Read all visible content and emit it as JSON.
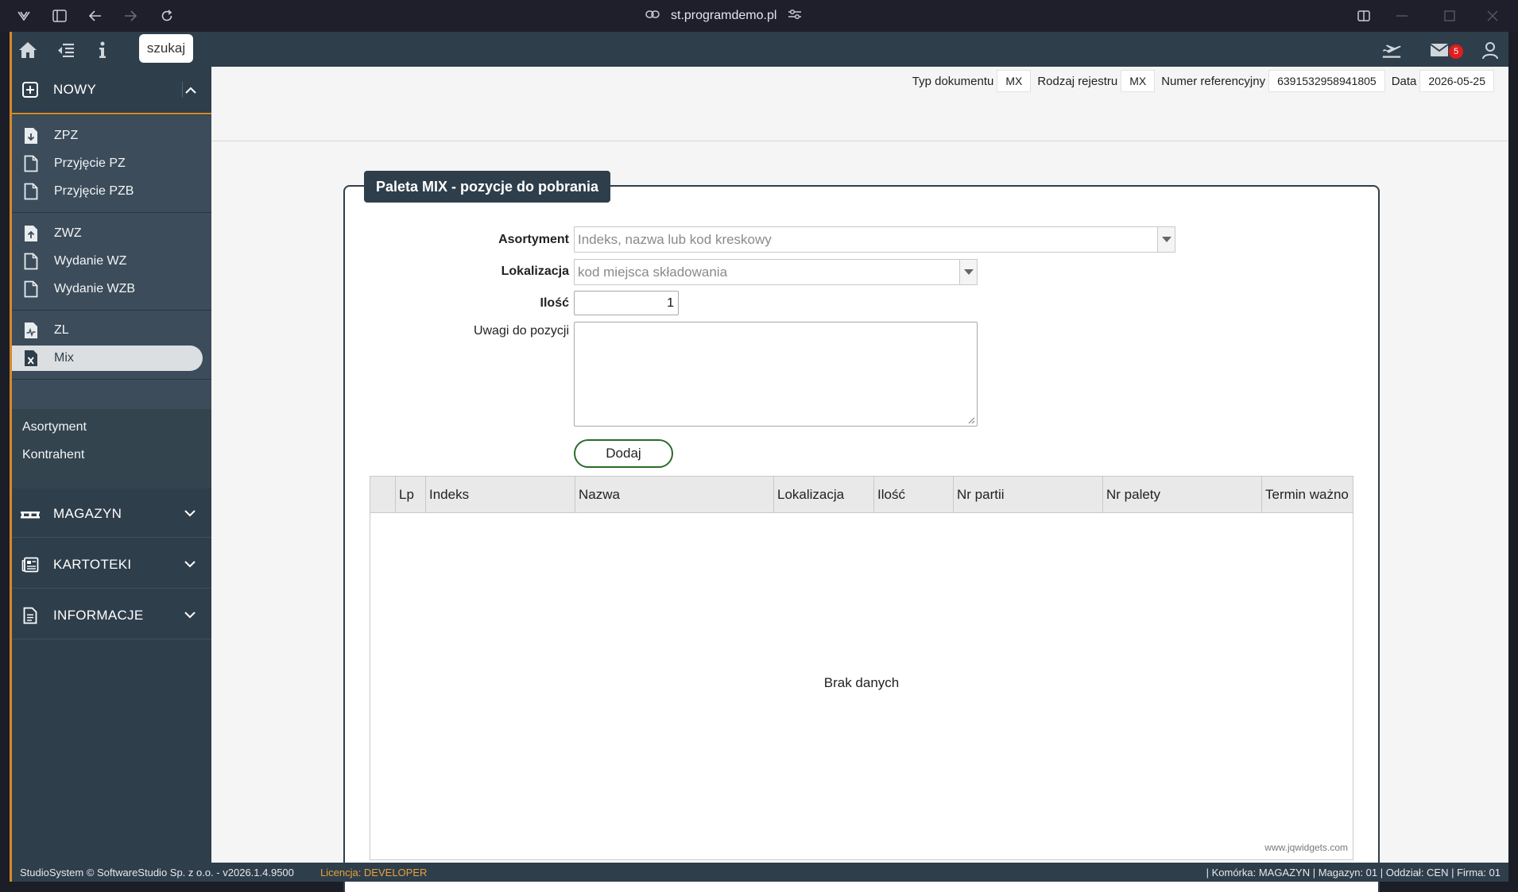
{
  "browser": {
    "url": "st.programdemo.pl"
  },
  "topbar": {
    "search_label": "szukaj",
    "mail_count": "5"
  },
  "sidebar": {
    "nowy_label": "NOWY",
    "items": [
      {
        "label": "ZPZ"
      },
      {
        "label": "Przyjęcie PZ"
      },
      {
        "label": "Przyjęcie PZB"
      },
      {
        "label": "ZWZ"
      },
      {
        "label": "Wydanie WZ"
      },
      {
        "label": "Wydanie WZB"
      },
      {
        "label": "ZL"
      },
      {
        "label": "Mix"
      }
    ],
    "links": [
      {
        "label": "Asortyment"
      },
      {
        "label": "Kontrahent"
      }
    ],
    "sections": [
      {
        "label": "MAGAZYN"
      },
      {
        "label": "KARTOTEKI"
      },
      {
        "label": "INFORMACJE"
      }
    ]
  },
  "header": {
    "typ_label": "Typ dokumentu",
    "typ_value": "MX",
    "rodzaj_label": "Rodzaj rejestru",
    "rodzaj_value": "MX",
    "numer_label": "Numer referencyjny",
    "numer_value": "6391532958941805",
    "data_label": "Data",
    "data_value": "2026-05-25"
  },
  "form": {
    "title": "Paleta MIX - pozycje do pobrania",
    "asortyment_label": "Asortyment",
    "asortyment_placeholder": "Indeks, nazwa lub kod kreskowy",
    "lokalizacja_label": "Lokalizacja",
    "lokalizacja_placeholder": "kod miejsca składowania",
    "ilosc_label": "Ilość",
    "ilosc_value": "1",
    "uwagi_label": "Uwagi do pozycji",
    "add_button": "Dodaj"
  },
  "grid": {
    "columns": [
      "Lp",
      "Indeks",
      "Nazwa",
      "Lokalizacja",
      "Ilość",
      "Nr partii",
      "Nr palety",
      "Termin ważno"
    ],
    "empty_message": "Brak danych",
    "credit": "www.jqwidgets.com"
  },
  "status": {
    "left": "StudioSystem © SoftwareStudio Sp. z o.o. - v2026.1.4.9500",
    "license": "Licencja: DEVELOPER",
    "right": "| Komórka: MAGAZYN | Magazyn: 01 | Oddział: CEN | Firma: 01"
  },
  "colors": {
    "sidebar": "#2f3e4b",
    "submenu": "#3c4c5a",
    "accent": "#d48a2a",
    "add_border": "#2a6b2a",
    "badge": "#e21d1d"
  }
}
